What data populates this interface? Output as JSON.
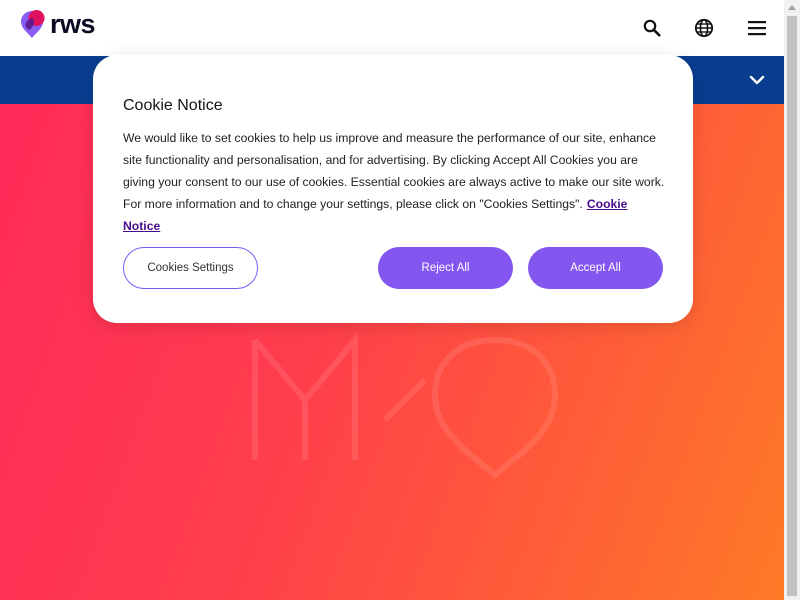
{
  "header": {
    "logo_text": "rws",
    "icons": [
      "search-icon",
      "globe-icon",
      "menu-icon"
    ]
  },
  "nav": {
    "icon": "chevron-down-icon"
  },
  "cookie": {
    "title": "Cookie Notice",
    "body": "We would like to set cookies to help us improve and measure the performance of our site, enhance site functionality and personalisation, and for advertising. By clicking Accept All Cookies you are giving your consent to our use of cookies. Essential cookies are always active to make our site work. For more information and to change your settings, please click on \"Cookies Settings\".",
    "link": "Cookie Notice",
    "buttons": {
      "settings": "Cookies Settings",
      "reject": "Reject All",
      "accept": "Accept All"
    }
  },
  "colors": {
    "nav_blue": "#0a3d8f",
    "button_purple": "#8456f0",
    "link_purple": "#4a0b8c",
    "hero_start": "#ff2a5a",
    "hero_end": "#ff7a26"
  }
}
